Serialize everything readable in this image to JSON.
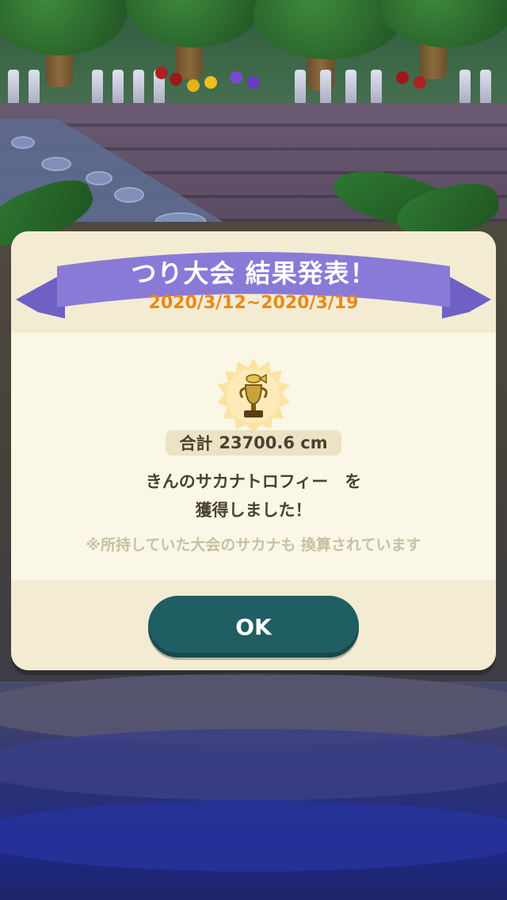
{
  "dialog": {
    "title": "つり大会 結果発表！",
    "period": "2020/3/12~2020/3/19",
    "total_label": "合計",
    "total_value": "23700.6 cm",
    "message_line1": "きんのサカナトロフィー　を",
    "message_line2": "獲得しました！",
    "note": "※所持していた大会のサカナも 換算されています",
    "ok_label": "OK"
  },
  "colors": {
    "ribbon": "#8a7ad8",
    "period_text": "#e8891a",
    "ok_button": "#1f5e62",
    "badge": "#fbe3a3"
  },
  "icons": {
    "trophy": "gold-fish-trophy-icon"
  }
}
